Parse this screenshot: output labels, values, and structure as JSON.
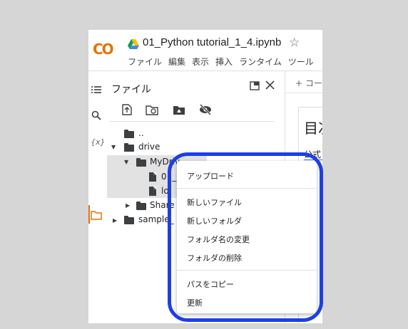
{
  "header": {
    "logo": "CO",
    "title": "01_Python tutorial_1_4.ipynb",
    "menu": [
      "ファイル",
      "編集",
      "表示",
      "挿入",
      "ランタイム",
      "ツール"
    ]
  },
  "panel": {
    "title": "ファイル"
  },
  "tree": {
    "parent": "..",
    "drive": "drive",
    "mydrive": "MyDriv",
    "file1": "01_",
    "file2": "lo",
    "shared": "Share",
    "sample": "sample_"
  },
  "right": {
    "code_button": "+ コー",
    "heading": "目次",
    "subtext": "公式"
  },
  "context_menu": {
    "items": [
      "アップロード",
      "新しいファイル",
      "新しいフォルダ",
      "フォルダ名の変更",
      "フォルダの削除",
      "パスをコピー",
      "更新"
    ]
  },
  "colors": {
    "highlight": "#1d3fe6",
    "active_rail": "#e8710a",
    "logo": "#f9ab00"
  }
}
